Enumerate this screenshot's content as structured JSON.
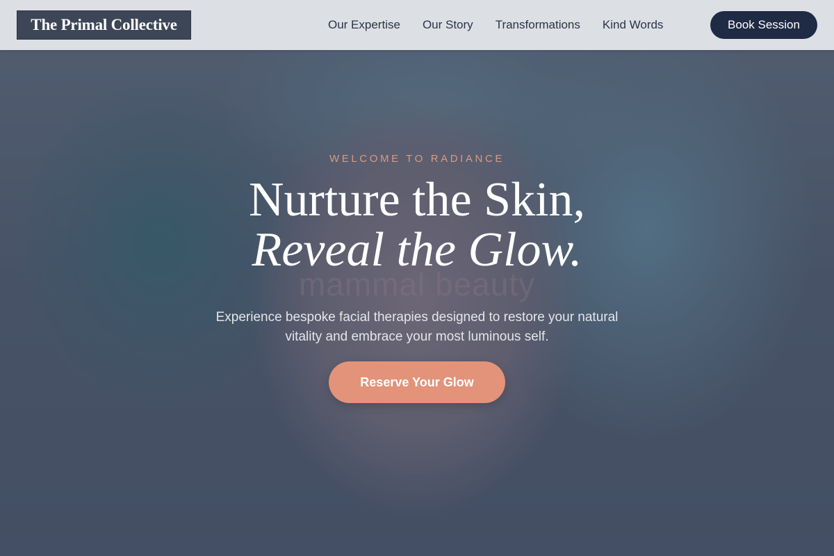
{
  "header": {
    "logo_text": "The Primal Collective",
    "nav": [
      {
        "label": "Our Expertise"
      },
      {
        "label": "Our Story"
      },
      {
        "label": "Transformations"
      },
      {
        "label": "Kind Words"
      }
    ],
    "book_button": "Book Session"
  },
  "hero": {
    "watermark": "mammal beauty",
    "eyebrow": "WELCOME TO RADIANCE",
    "headline_line1": "Nurture the Skin,",
    "headline_line2": "Reveal the Glow.",
    "subtext": "Experience bespoke facial therapies designed to restore your natural vitality and embrace your most luminous self.",
    "cta": "Reserve Your Glow"
  },
  "colors": {
    "accent": "#e3937a",
    "navy": "#1f2a44",
    "eyebrow": "#d99a80"
  }
}
